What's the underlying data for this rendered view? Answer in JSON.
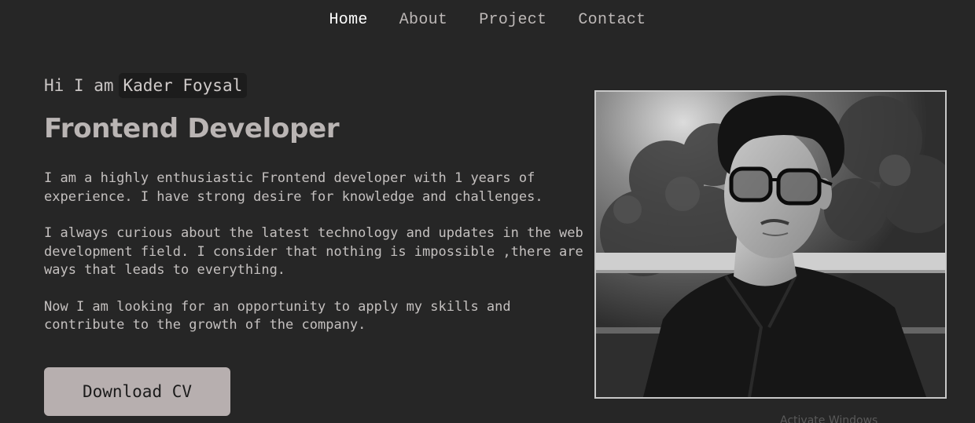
{
  "nav": {
    "items": [
      {
        "label": "Home",
        "active": true
      },
      {
        "label": "About",
        "active": false
      },
      {
        "label": "Project",
        "active": false
      },
      {
        "label": "Contact",
        "active": false
      }
    ]
  },
  "hero": {
    "greeting_prefix": "Hi I am",
    "name": "Kader Foysal",
    "role": "Frontend Developer",
    "paragraphs": [
      "I am a highly enthusiastic Frontend developer with 1 years of experience. I have strong desire for knowledge and challenges.",
      "I always curious about the latest technology and updates in the web development field. I consider that nothing is impossible ,there are ways that leads to everything.",
      "Now I am looking for an opportunity to apply my skills and contribute to the growth of the company."
    ],
    "cv_button": "Download CV"
  },
  "photo": {
    "icon": "profile-photo"
  },
  "watermark": "Activate Windows"
}
